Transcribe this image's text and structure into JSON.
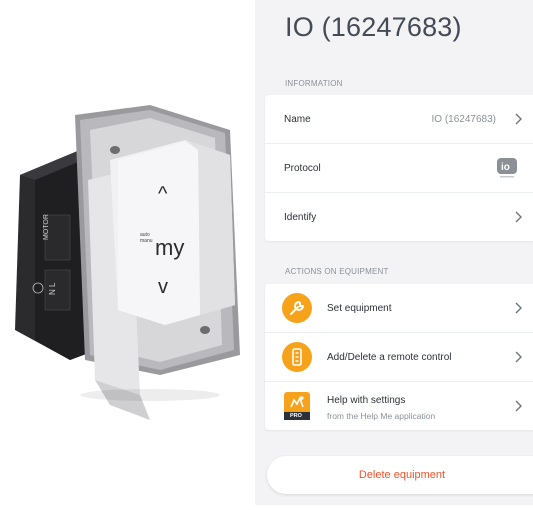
{
  "device": {
    "title": "IO (16247683)"
  },
  "information": {
    "section_label": "INFORMATION",
    "name_label": "Name",
    "name_value": "IO (16247683)",
    "protocol_label": "Protocol",
    "protocol_logo_text": "io",
    "identify_label": "Identify"
  },
  "actions": {
    "section_label": "ACTIONS ON EQUIPMENT",
    "items": [
      {
        "label": "Set equipment",
        "icon": "wrench-icon"
      },
      {
        "label": "Add/Delete a remote control",
        "icon": "remote-control-icon"
      },
      {
        "label": "Help with settings",
        "sublabel": "from the Help Me application",
        "icon": "help-me-app-icon",
        "badge": "PRO"
      }
    ]
  },
  "delete_button": {
    "label": "Delete equipment"
  },
  "product_image": {
    "remote_up_symbol": "^",
    "remote_down_symbol": "v",
    "remote_my_label": "my",
    "remote_small_text": "auto\nmanu",
    "socket_labels": [
      "MOTOR",
      "N L"
    ]
  },
  "colors": {
    "accent_orange": "#f7a21b",
    "delete_red": "#e9542a",
    "panel_bg": "#f3f3f5",
    "title_color": "#444a56"
  }
}
